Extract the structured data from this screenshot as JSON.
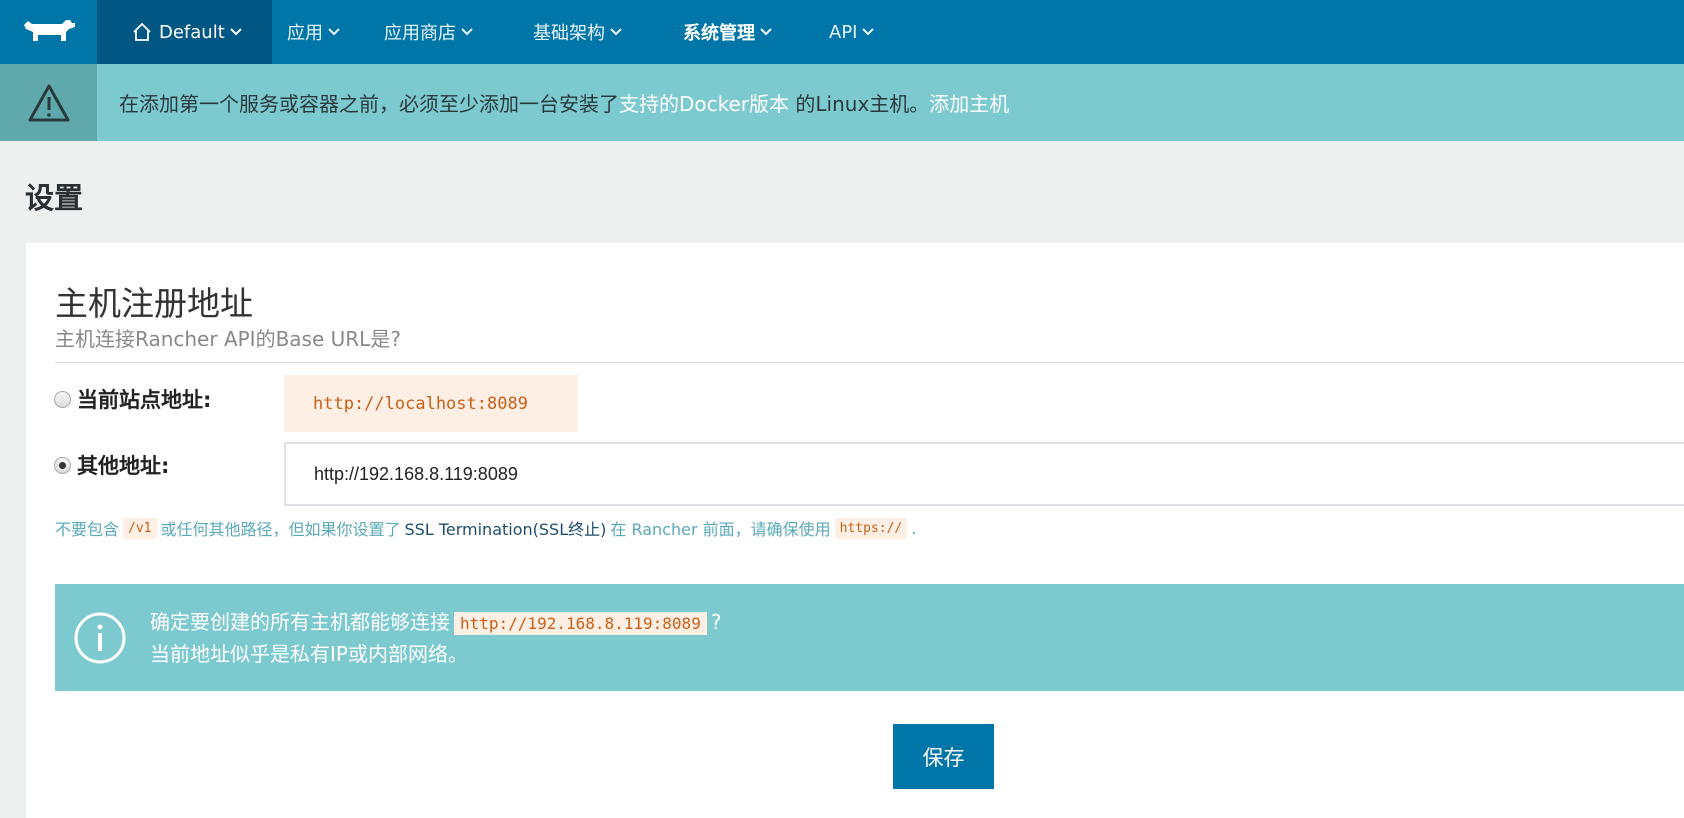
{
  "nav": {
    "environment": "Default",
    "items": [
      {
        "label": "应用"
      },
      {
        "label": "应用商店"
      },
      {
        "label": "基础架构"
      },
      {
        "label": "系统管理"
      },
      {
        "label": "API"
      }
    ]
  },
  "alert": {
    "text_before": "在添加第一个服务或容器之前，必须至少添加一台安装了",
    "link_docker": "支持的Docker版本",
    "text_middle": " 的Linux主机。",
    "link_add_host": "添加主机"
  },
  "page": {
    "title": "设置"
  },
  "section": {
    "title": "主机注册地址",
    "subtitle": "主机连接Rancher API的Base URL是?"
  },
  "options": {
    "current_label": "当前站点地址:",
    "current_value": "http://localhost:8089",
    "other_label": "其他地址:",
    "other_value": "http://192.168.8.119:8089",
    "selected": "other"
  },
  "help": {
    "t1": "不要包含",
    "code1": "/v1",
    "t2": "或任何其他路径，但如果你设置了",
    "t3": "SSL Termination(SSL终止)",
    "t4": "在 Rancher 前面，请确保使用",
    "code2": "https://",
    "t5": "."
  },
  "info": {
    "line1_before": "确定要创建的所有主机都能够连接",
    "line1_code": "http://192.168.8.119:8089",
    "line1_after": "?",
    "line2": "当前地址似乎是私有IP或内部网络。"
  },
  "buttons": {
    "save": "保存"
  },
  "colors": {
    "nav_bg": "#0075a8",
    "env_bg": "#005783",
    "alert_bg": "#7cc9cf",
    "code_text": "#c8601a",
    "code_bg": "#fdefe4"
  }
}
